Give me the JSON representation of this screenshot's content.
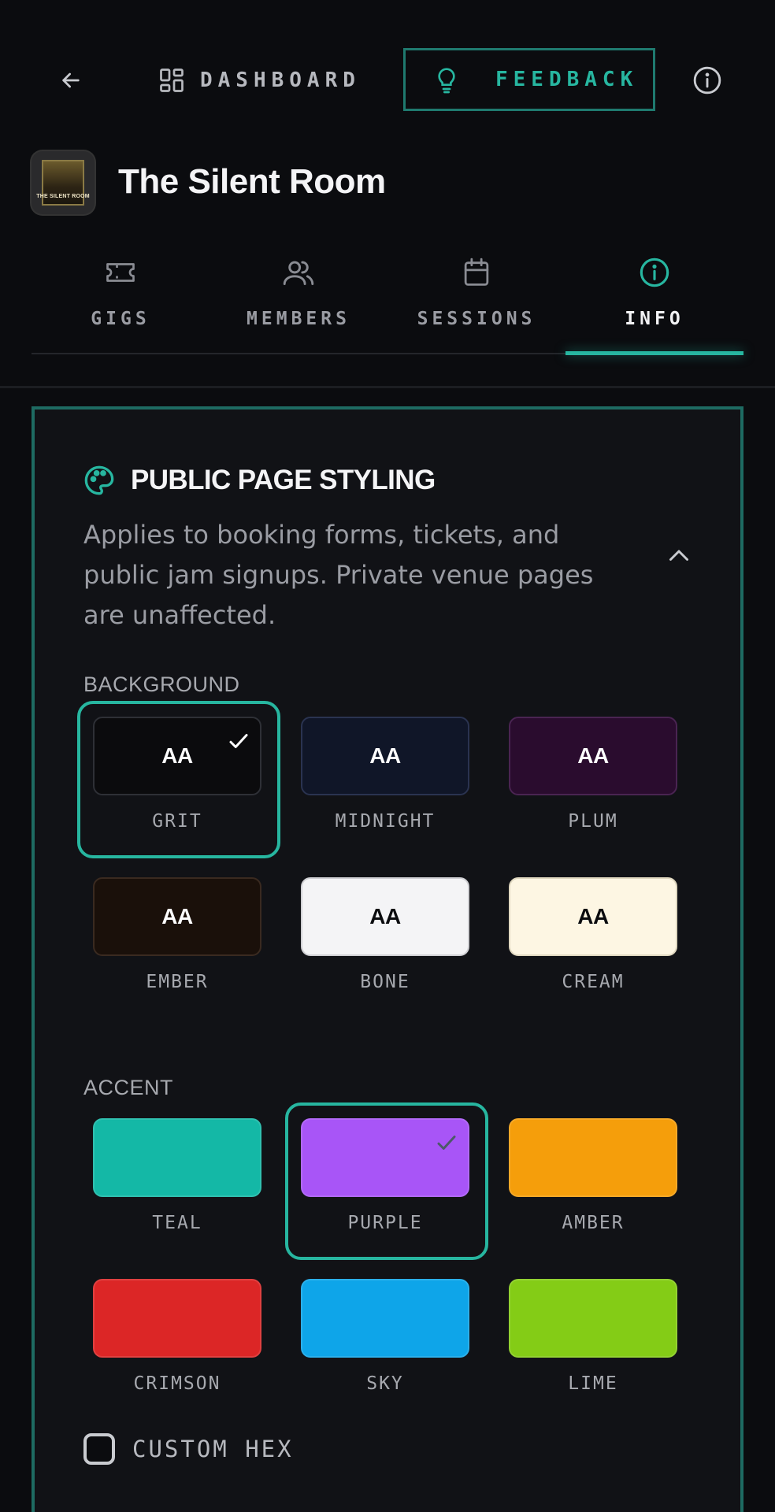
{
  "nav": {
    "dashboard_label": "DASHBOARD",
    "feedback_label": "FEEDBACK"
  },
  "venue": {
    "name": "The Silent Room",
    "logo_text": "THE SILENT ROOM"
  },
  "tabs": [
    {
      "label": "GIGS",
      "icon": "ticket-icon",
      "active": false
    },
    {
      "label": "MEMBERS",
      "icon": "users-icon",
      "active": false
    },
    {
      "label": "SESSIONS",
      "icon": "calendar-icon",
      "active": false
    },
    {
      "label": "INFO",
      "icon": "info-icon",
      "active": true
    }
  ],
  "styling": {
    "title": "PUBLIC PAGE STYLING",
    "description": "Applies to booking forms, tickets, and public jam signups. Private venue pages are unaffected.",
    "background_label": "BACKGROUND",
    "backgrounds": [
      {
        "name": "GRIT",
        "sample": "AA",
        "color": "#0b0b0d",
        "text_color": "#ffffff",
        "border": "#2e3036",
        "selected": true
      },
      {
        "name": "MIDNIGHT",
        "sample": "AA",
        "color": "#101628",
        "text_color": "#ffffff",
        "border": "#2a3350",
        "selected": false
      },
      {
        "name": "PLUM",
        "sample": "AA",
        "color": "#2a0c2e",
        "text_color": "#ffffff",
        "border": "#4a2452",
        "selected": false
      },
      {
        "name": "EMBER",
        "sample": "AA",
        "color": "#1a100a",
        "text_color": "#ffffff",
        "border": "#3a2a20",
        "selected": false
      },
      {
        "name": "BONE",
        "sample": "AA",
        "color": "#f4f4f6",
        "text_color": "#0b0c0f",
        "border": "#d0d0d4",
        "selected": false
      },
      {
        "name": "CREAM",
        "sample": "AA",
        "color": "#fdf6e3",
        "text_color": "#0b0c0f",
        "border": "#e0d8c0",
        "selected": false
      }
    ],
    "accent_label": "ACCENT",
    "accents": [
      {
        "name": "TEAL",
        "color": "#14b8a6",
        "selected": false
      },
      {
        "name": "PURPLE",
        "color": "#a855f7",
        "selected": true
      },
      {
        "name": "AMBER",
        "color": "#f59e0b",
        "selected": false
      },
      {
        "name": "CRIMSON",
        "color": "#dc2626",
        "selected": false
      },
      {
        "name": "SKY",
        "color": "#0ea5e9",
        "selected": false
      },
      {
        "name": "LIME",
        "color": "#84cc16",
        "selected": false
      }
    ],
    "custom_hex_label": "CUSTOM HEX",
    "custom_hex_checked": false
  },
  "colors": {
    "accent": "#27b6a0",
    "panel_border": "#1e6b62"
  }
}
